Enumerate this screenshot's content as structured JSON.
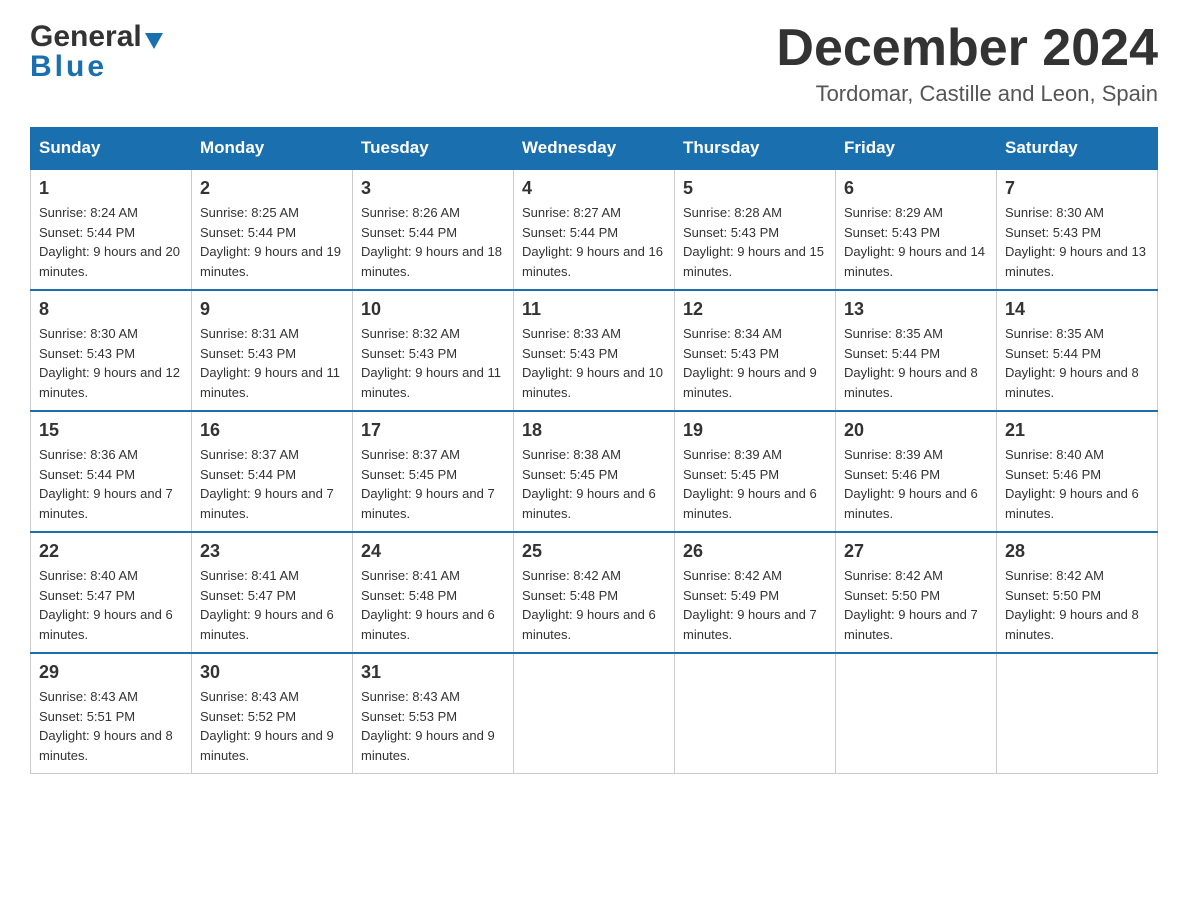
{
  "header": {
    "logo_general": "General",
    "logo_blue": "Blue",
    "month_title": "December 2024",
    "subtitle": "Tordomar, Castille and Leon, Spain"
  },
  "days_of_week": [
    "Sunday",
    "Monday",
    "Tuesday",
    "Wednesday",
    "Thursday",
    "Friday",
    "Saturday"
  ],
  "weeks": [
    [
      {
        "day": "1",
        "sunrise": "8:24 AM",
        "sunset": "5:44 PM",
        "daylight": "9 hours and 20 minutes."
      },
      {
        "day": "2",
        "sunrise": "8:25 AM",
        "sunset": "5:44 PM",
        "daylight": "9 hours and 19 minutes."
      },
      {
        "day": "3",
        "sunrise": "8:26 AM",
        "sunset": "5:44 PM",
        "daylight": "9 hours and 18 minutes."
      },
      {
        "day": "4",
        "sunrise": "8:27 AM",
        "sunset": "5:44 PM",
        "daylight": "9 hours and 16 minutes."
      },
      {
        "day": "5",
        "sunrise": "8:28 AM",
        "sunset": "5:43 PM",
        "daylight": "9 hours and 15 minutes."
      },
      {
        "day": "6",
        "sunrise": "8:29 AM",
        "sunset": "5:43 PM",
        "daylight": "9 hours and 14 minutes."
      },
      {
        "day": "7",
        "sunrise": "8:30 AM",
        "sunset": "5:43 PM",
        "daylight": "9 hours and 13 minutes."
      }
    ],
    [
      {
        "day": "8",
        "sunrise": "8:30 AM",
        "sunset": "5:43 PM",
        "daylight": "9 hours and 12 minutes."
      },
      {
        "day": "9",
        "sunrise": "8:31 AM",
        "sunset": "5:43 PM",
        "daylight": "9 hours and 11 minutes."
      },
      {
        "day": "10",
        "sunrise": "8:32 AM",
        "sunset": "5:43 PM",
        "daylight": "9 hours and 11 minutes."
      },
      {
        "day": "11",
        "sunrise": "8:33 AM",
        "sunset": "5:43 PM",
        "daylight": "9 hours and 10 minutes."
      },
      {
        "day": "12",
        "sunrise": "8:34 AM",
        "sunset": "5:43 PM",
        "daylight": "9 hours and 9 minutes."
      },
      {
        "day": "13",
        "sunrise": "8:35 AM",
        "sunset": "5:44 PM",
        "daylight": "9 hours and 8 minutes."
      },
      {
        "day": "14",
        "sunrise": "8:35 AM",
        "sunset": "5:44 PM",
        "daylight": "9 hours and 8 minutes."
      }
    ],
    [
      {
        "day": "15",
        "sunrise": "8:36 AM",
        "sunset": "5:44 PM",
        "daylight": "9 hours and 7 minutes."
      },
      {
        "day": "16",
        "sunrise": "8:37 AM",
        "sunset": "5:44 PM",
        "daylight": "9 hours and 7 minutes."
      },
      {
        "day": "17",
        "sunrise": "8:37 AM",
        "sunset": "5:45 PM",
        "daylight": "9 hours and 7 minutes."
      },
      {
        "day": "18",
        "sunrise": "8:38 AM",
        "sunset": "5:45 PM",
        "daylight": "9 hours and 6 minutes."
      },
      {
        "day": "19",
        "sunrise": "8:39 AM",
        "sunset": "5:45 PM",
        "daylight": "9 hours and 6 minutes."
      },
      {
        "day": "20",
        "sunrise": "8:39 AM",
        "sunset": "5:46 PM",
        "daylight": "9 hours and 6 minutes."
      },
      {
        "day": "21",
        "sunrise": "8:40 AM",
        "sunset": "5:46 PM",
        "daylight": "9 hours and 6 minutes."
      }
    ],
    [
      {
        "day": "22",
        "sunrise": "8:40 AM",
        "sunset": "5:47 PM",
        "daylight": "9 hours and 6 minutes."
      },
      {
        "day": "23",
        "sunrise": "8:41 AM",
        "sunset": "5:47 PM",
        "daylight": "9 hours and 6 minutes."
      },
      {
        "day": "24",
        "sunrise": "8:41 AM",
        "sunset": "5:48 PM",
        "daylight": "9 hours and 6 minutes."
      },
      {
        "day": "25",
        "sunrise": "8:42 AM",
        "sunset": "5:48 PM",
        "daylight": "9 hours and 6 minutes."
      },
      {
        "day": "26",
        "sunrise": "8:42 AM",
        "sunset": "5:49 PM",
        "daylight": "9 hours and 7 minutes."
      },
      {
        "day": "27",
        "sunrise": "8:42 AM",
        "sunset": "5:50 PM",
        "daylight": "9 hours and 7 minutes."
      },
      {
        "day": "28",
        "sunrise": "8:42 AM",
        "sunset": "5:50 PM",
        "daylight": "9 hours and 8 minutes."
      }
    ],
    [
      {
        "day": "29",
        "sunrise": "8:43 AM",
        "sunset": "5:51 PM",
        "daylight": "9 hours and 8 minutes."
      },
      {
        "day": "30",
        "sunrise": "8:43 AM",
        "sunset": "5:52 PM",
        "daylight": "9 hours and 9 minutes."
      },
      {
        "day": "31",
        "sunrise": "8:43 AM",
        "sunset": "5:53 PM",
        "daylight": "9 hours and 9 minutes."
      },
      null,
      null,
      null,
      null
    ]
  ]
}
